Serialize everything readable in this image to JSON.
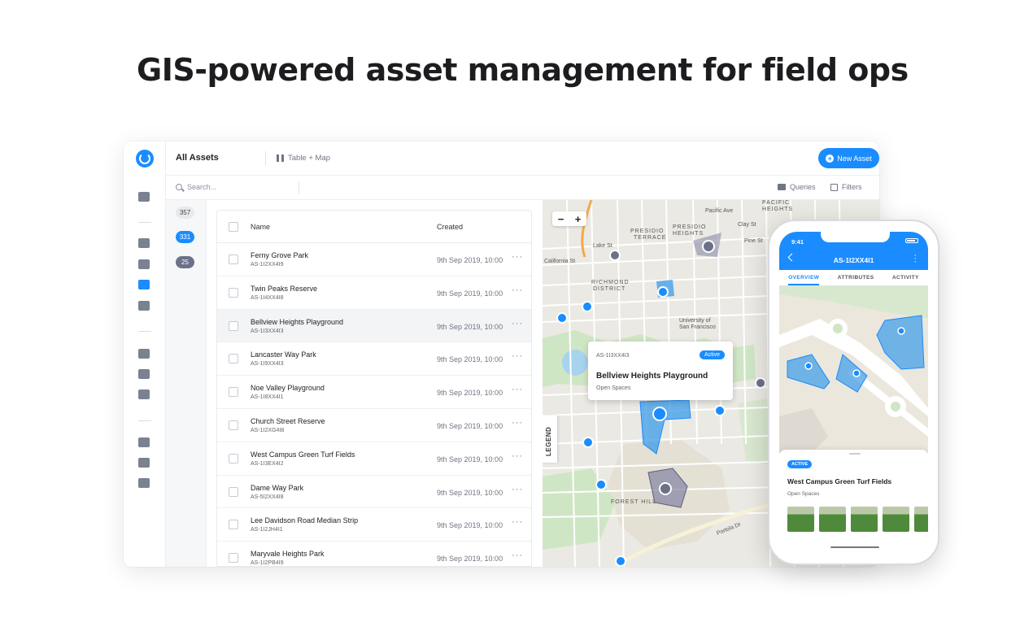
{
  "headline": "GIS-powered asset management for field ops",
  "topbar": {
    "title": "All Assets",
    "view_label": "Table + Map",
    "new_asset_label": "New Asset"
  },
  "search": {
    "placeholder": "Search...",
    "queries_label": "Queries",
    "filters_label": "Filters"
  },
  "counts": [
    "357",
    "331",
    "25"
  ],
  "table": {
    "headers": {
      "name": "Name",
      "created": "Created"
    },
    "rows": [
      {
        "name": "Ferny Grove Park",
        "code": "AS-1I2XX4I9",
        "created": "9th Sep 2019, 10:00"
      },
      {
        "name": "Twin Peaks Reserve",
        "code": "AS-1I4XX4I8",
        "created": "9th Sep 2019, 10:00"
      },
      {
        "name": "Bellview Heights Playground",
        "code": "AS-1I3XX4I3",
        "created": "9th Sep 2019, 10:00"
      },
      {
        "name": "Lancaster Way Park",
        "code": "AS-1I9XX4I3",
        "created": "9th Sep 2019, 10:00"
      },
      {
        "name": "Noe Valley Playground",
        "code": "AS-1I8XX4I1",
        "created": "9th Sep 2019, 10:00"
      },
      {
        "name": "Church Street Reserve",
        "code": "AS-1I2XG4I8",
        "created": "9th Sep 2019, 10:00"
      },
      {
        "name": "West Campus Green Turf Fields",
        "code": "AS-1I3EX4I2",
        "created": "9th Sep 2019, 10:00"
      },
      {
        "name": "Dame Way Park",
        "code": "AS-5I2XX4I8",
        "created": "9th Sep 2019, 10:00"
      },
      {
        "name": "Lee Davidson Road Median Strip",
        "code": "AS-1I2JH4I1",
        "created": "9th Sep 2019, 10:00"
      },
      {
        "name": "Maryvale Heights Park",
        "code": "AS-1I2PB4I9",
        "created": "9th Sep 2019, 10:00"
      }
    ],
    "more_label": "···"
  },
  "map": {
    "zoom_out": "−",
    "zoom_in": "+",
    "legend_label": "LEGEND",
    "popup": {
      "id": "AS-1I3XX4I3",
      "status": "Active",
      "name": "Bellview Heights Playground",
      "type": "Open Spaces"
    },
    "labels": {
      "presidio_terrace": "PRESIDIO\nTERRACE",
      "presidio_heights": "PRESIDIO\nHEIGHTS",
      "pacific_heights": "PACIFIC\nHEIGHTS",
      "richmond": "RICHMOND\nDISTRICT",
      "california_st": "California St",
      "lake_st": "Lake St",
      "clay_st": "Clay St",
      "pine_st": "Pine St",
      "pacific_ave": "Pacific Ave",
      "usf": "University of\nSan Francisco",
      "forest_hill": "FOREST HILL",
      "portola": "Portola Dr"
    }
  },
  "phone": {
    "time": "9:41",
    "title": "AS-1I2XX4I1",
    "tabs": [
      "OVERVIEW",
      "ATTRIBUTES",
      "ACTIVITY"
    ],
    "status": "ACTIVE",
    "name": "West Campus Green Turf Fields",
    "type": "Open Spaces"
  },
  "colors": {
    "accent": "#1a8cff",
    "slate": "#6c7189",
    "polygon": "#3a9be8"
  }
}
